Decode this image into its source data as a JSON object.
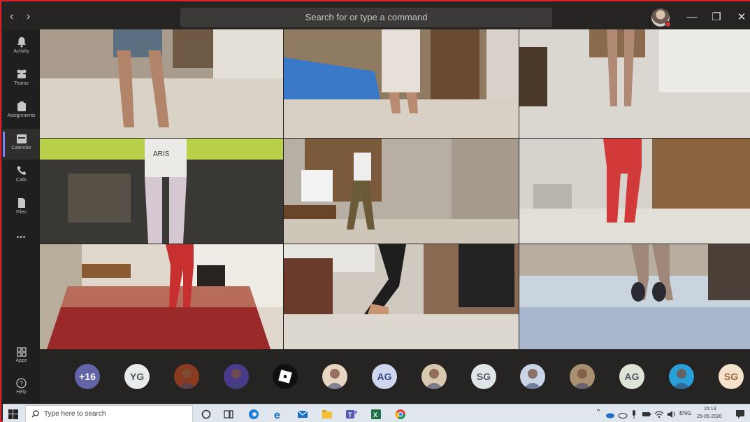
{
  "titlebar": {
    "back_icon": "chevron-left-icon",
    "forward_icon": "chevron-right-icon",
    "search_placeholder": "Search for or type a command",
    "minimize": "—",
    "maximize": "❐",
    "close": "✕"
  },
  "rail": {
    "items": [
      {
        "label": "Activity",
        "icon": "bell-icon"
      },
      {
        "label": "Teams",
        "icon": "teams-icon"
      },
      {
        "label": "Assignments",
        "icon": "assignments-icon"
      },
      {
        "label": "Calendar",
        "icon": "calendar-icon"
      },
      {
        "label": "Calls",
        "icon": "phone-icon"
      },
      {
        "label": "Files",
        "icon": "file-icon"
      }
    ],
    "more": "•••",
    "apps_label": "Apps",
    "help_label": "Help"
  },
  "participants": {
    "overflow_count": "+16",
    "avatars": [
      {
        "initials": "YG",
        "bg": "#e8ecec",
        "fg": "#555"
      },
      {
        "initials": "",
        "kind": "photo",
        "bg": "#8a3a1e"
      },
      {
        "initials": "",
        "kind": "photo",
        "bg": "#4a3a8c"
      },
      {
        "initials": "",
        "kind": "roblox",
        "bg": "#101010"
      },
      {
        "initials": "",
        "kind": "photo",
        "bg": "#e8d6c2"
      },
      {
        "initials": "AG",
        "bg": "#cfd7ef",
        "fg": "#3b4a8a"
      },
      {
        "initials": "",
        "kind": "photo",
        "bg": "#d8c8b0"
      },
      {
        "initials": "SG",
        "bg": "#e0e6e8",
        "fg": "#556"
      },
      {
        "initials": "",
        "kind": "photo",
        "bg": "#c9d4e6"
      },
      {
        "initials": "",
        "kind": "photo",
        "bg": "#a89070"
      },
      {
        "initials": "AG",
        "bg": "#dfe5d6",
        "fg": "#556"
      },
      {
        "initials": "",
        "kind": "photo",
        "bg": "#2aa0d8"
      },
      {
        "initials": "SG",
        "bg": "#f4e2cc",
        "fg": "#a0653a"
      }
    ]
  },
  "taskbar": {
    "search_placeholder": "Type here to search",
    "lang": "ENG",
    "time": "15:13",
    "date": "25-05-2020"
  },
  "colors": {
    "accent": "#7f85f5",
    "frame_border": "#e0202a",
    "overflow_bg": "#6264a7"
  }
}
